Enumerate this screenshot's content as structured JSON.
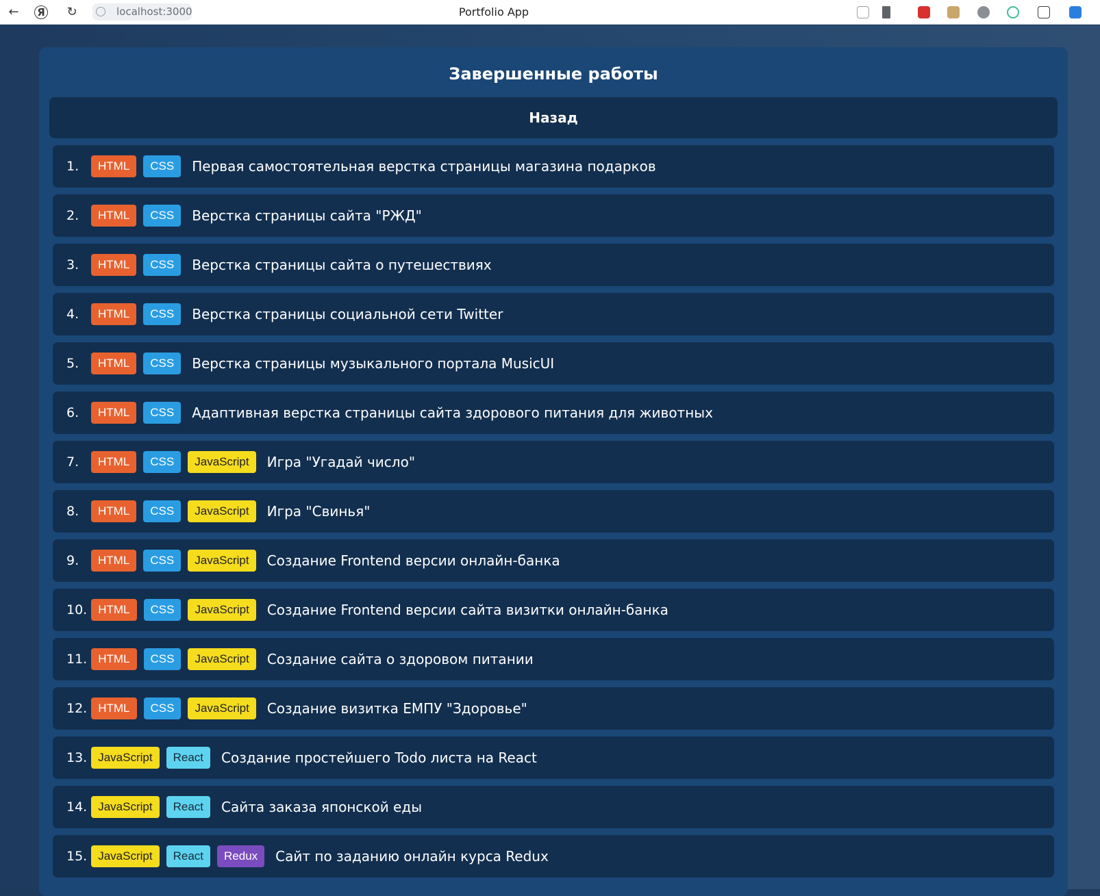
{
  "browser": {
    "url": "localhost:3000",
    "tab_title": "Portfolio App",
    "back_icon": "←",
    "reload_icon": "↻",
    "shield_icon": "Я"
  },
  "page": {
    "title": "Завершенные работы",
    "back_label": "Назад",
    "items": [
      {
        "num": "1.",
        "tags": [
          "HTML",
          "CSS"
        ],
        "title": "Первая самостоятельная верстка страницы магазина подарков"
      },
      {
        "num": "2.",
        "tags": [
          "HTML",
          "CSS"
        ],
        "title": "Верстка страницы сайта \"РЖД\""
      },
      {
        "num": "3.",
        "tags": [
          "HTML",
          "CSS"
        ],
        "title": "Верстка страницы сайта о путешествиях"
      },
      {
        "num": "4.",
        "tags": [
          "HTML",
          "CSS"
        ],
        "title": "Верстка страницы социальной сети Twitter"
      },
      {
        "num": "5.",
        "tags": [
          "HTML",
          "CSS"
        ],
        "title": "Верстка страницы музыкального портала MusicUI"
      },
      {
        "num": "6.",
        "tags": [
          "HTML",
          "CSS"
        ],
        "title": "Адаптивная верстка страницы сайта здорового питания для животных"
      },
      {
        "num": "7.",
        "tags": [
          "HTML",
          "CSS",
          "JavaScript"
        ],
        "title": "Игра \"Угадай число\""
      },
      {
        "num": "8.",
        "tags": [
          "HTML",
          "CSS",
          "JavaScript"
        ],
        "title": "Игра \"Свинья\""
      },
      {
        "num": "9.",
        "tags": [
          "HTML",
          "CSS",
          "JavaScript"
        ],
        "title": "Создание Frontend версии онлайн-банка"
      },
      {
        "num": "10.",
        "tags": [
          "HTML",
          "CSS",
          "JavaScript"
        ],
        "title": "Создание Frontend версии сайта визитки онлайн-банка"
      },
      {
        "num": "11.",
        "tags": [
          "HTML",
          "CSS",
          "JavaScript"
        ],
        "title": "Создание сайта о здоровом питании"
      },
      {
        "num": "12.",
        "tags": [
          "HTML",
          "CSS",
          "JavaScript"
        ],
        "title": "Создание визитка ЕМПУ \"Здоровье\""
      },
      {
        "num": "13.",
        "tags": [
          "JavaScript",
          "React"
        ],
        "title": "Создание простейшего Todo листа на React"
      },
      {
        "num": "14.",
        "tags": [
          "JavaScript",
          "React"
        ],
        "title": "Сайта заказа японской еды"
      },
      {
        "num": "15.",
        "tags": [
          "JavaScript",
          "React",
          "Redux"
        ],
        "title": "Сайт по заданию онлайн курса Redux"
      }
    ]
  },
  "colors": {
    "html_tag": "#e8622f",
    "css_tag": "#2a9de2",
    "javascript_tag": "#f5dc1d",
    "react_tag": "#5dd3ef",
    "redux_tag": "#7b4cbf",
    "panel": "#1a4776",
    "item": "#132f4f"
  }
}
